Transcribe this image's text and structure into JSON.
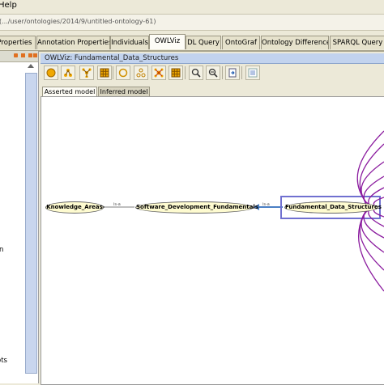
{
  "menu": {
    "help_label": "Help"
  },
  "url": {
    "path": "(.../user/ontologies/2014/9/untitled-ontology-61)"
  },
  "tabs": [
    {
      "label": "Properties"
    },
    {
      "label": "Annotation Properties"
    },
    {
      "label": "Individuals"
    },
    {
      "label": "OWLViz"
    },
    {
      "label": "DL Query"
    },
    {
      "label": "OntoGraf"
    },
    {
      "label": "Ontology Differences"
    },
    {
      "label": "SPARQL Query"
    }
  ],
  "left_panel": {
    "text_a": "n",
    "text_b": "ots"
  },
  "owlviz": {
    "header": "OWLViz: Fundamental_Data_Structures",
    "toolbar_icons": [
      "circle-icon",
      "tree-icon",
      "radial-tree-icon",
      "grid-icon",
      "hollow-circle-icon",
      "tree-outline-icon",
      "cross-layout-icon",
      "zoom-in-icon",
      "zoom-out-icon",
      "export-icon",
      "options-icon"
    ],
    "model_tabs": [
      {
        "label": "Asserted model"
      },
      {
        "label": "Inferred model"
      }
    ]
  },
  "graph": {
    "nodes": [
      {
        "label": "Knowledge_Areas"
      },
      {
        "label": "Software_Development_Fundamentals"
      },
      {
        "label": "Fundamental_Data_Structures"
      }
    ],
    "edges": [
      {
        "label": "is-a"
      },
      {
        "label": "is-a"
      }
    ],
    "colors": {
      "edge_main": "#4a7fc4",
      "edge_purple": "#8a1a9e",
      "selection": "#7070d0",
      "node_fill": "#fefbd0"
    }
  }
}
